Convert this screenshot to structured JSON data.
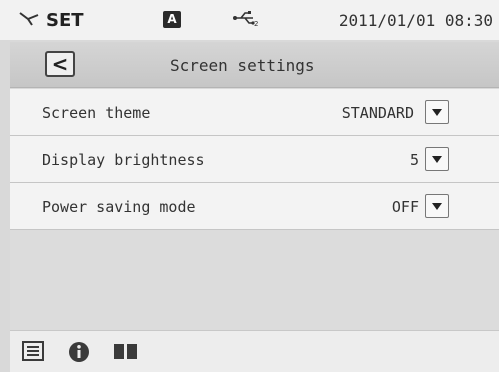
{
  "statusbar": {
    "mode_icon": "wrench-icon",
    "mode_label": "SET",
    "badge": "A",
    "usb_icon": "usb-icon",
    "datetime": "2011/01/01 08:30"
  },
  "header": {
    "back_label": "<",
    "title": "Screen settings"
  },
  "settings": [
    {
      "label": "Screen theme",
      "value": "STANDARD"
    },
    {
      "label": "Display brightness",
      "value": "5"
    },
    {
      "label": "Power saving mode",
      "value": "OFF"
    }
  ],
  "bottombar": {
    "icons": [
      "list-icon",
      "info-icon",
      "manual-icon"
    ]
  }
}
